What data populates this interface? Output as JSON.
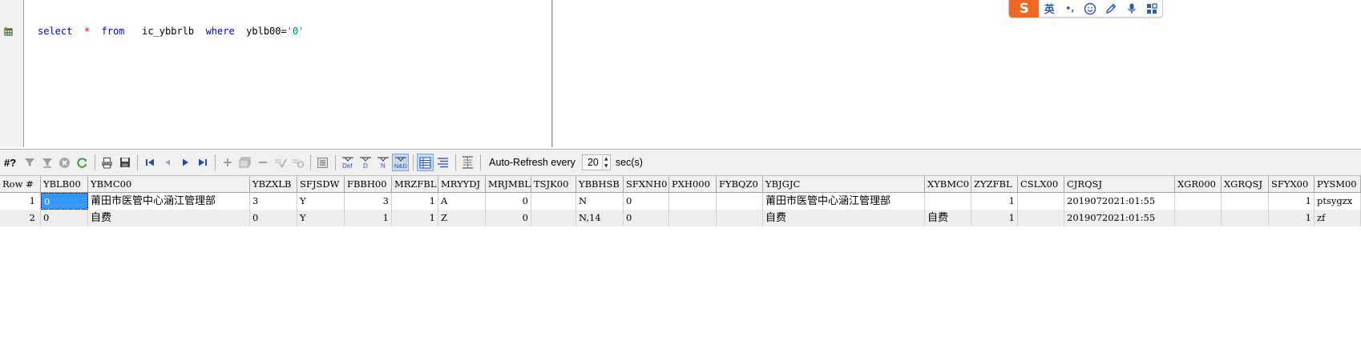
{
  "editor": {
    "sql": {
      "kw_select": "select",
      "star": "*",
      "kw_from": "from",
      "table": "ic_ybbrlb",
      "kw_where": "where",
      "condition_field": "yblb00=",
      "condition_value": "'0'"
    }
  },
  "ime": {
    "logo": "S",
    "lang": "英",
    "punct": "•,",
    "icons": [
      "smiley-icon",
      "pen-icon",
      "microphone-icon",
      "grid-icon"
    ]
  },
  "toolbar": {
    "query_label": "#?",
    "auto_refresh_label": "Auto-Refresh every",
    "refresh_interval": "20",
    "unit_label": "sec(s)",
    "buttons": [
      "filter-icon",
      "filter-clear-icon",
      "cancel-icon",
      "refresh-icon",
      "print-icon",
      "save-icon",
      "first-record-icon",
      "prior-record-icon",
      "next-record-icon",
      "last-record-icon",
      "insert-record-icon",
      "duplicate-record-icon",
      "delete-record-icon",
      "post-record-icon",
      "cancel-edit-icon",
      "single-record-view-icon",
      "show-default-icon",
      "show-d-icon",
      "show-n-icon",
      "show-nd-icon",
      "grid-view-icon",
      "text-view-icon",
      "auto-size-icon"
    ],
    "view_labels": {
      "def": "Def",
      "d": "D",
      "n": "N",
      "nd": "N&D"
    }
  },
  "grid": {
    "columns": [
      "Row #",
      "YBLB00",
      "YBMC00",
      "YBZXLB",
      "SFJSDW",
      "FBBH00",
      "MRZFBL",
      "MRYYDJ",
      "MRJMBL",
      "TSJK00",
      "YBBHSB",
      "SFXNH0",
      "PXH000",
      "FYBQZ0",
      "YBJGJC",
      "XYBMC0",
      "ZYZFBL",
      "CSLX00",
      "CJRQSJ",
      "XGR000",
      "XGRQSJ",
      "SFYX00",
      "PYSM00"
    ],
    "rows": [
      [
        "1",
        "0",
        "莆田市医管中心涵江管理部",
        "3",
        "Y",
        "3",
        "1",
        "A",
        "0",
        "",
        "N",
        "0",
        "",
        "",
        "莆田市医管中心涵江管理部",
        "",
        "1",
        "",
        "2019072021:01:55",
        "",
        "",
        "1",
        "ptsygzx"
      ],
      [
        "2",
        "0",
        "自费",
        "0",
        "Y",
        "1",
        "1",
        "Z",
        "0",
        "",
        "N,14",
        "0",
        "",
        "",
        "自费",
        "自费",
        "1",
        "",
        "2019072021:01:55",
        "",
        "",
        "1",
        "zf"
      ]
    ]
  }
}
